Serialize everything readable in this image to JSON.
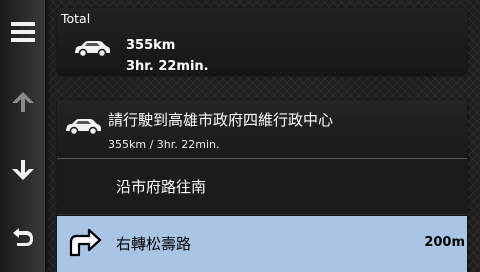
{
  "sidebar": {
    "buttons": [
      {
        "name": "menu",
        "icon": "menu-icon"
      },
      {
        "name": "scroll-up",
        "icon": "arrow-up-icon"
      },
      {
        "name": "scroll-down",
        "icon": "arrow-down-icon"
      },
      {
        "name": "back",
        "icon": "back-icon"
      }
    ]
  },
  "summary": {
    "label": "Total",
    "distance": "355km",
    "time": "3hr. 22min.",
    "icon": "car-icon"
  },
  "route": {
    "destination": {
      "title": "請行駛到高雄市政府四維行政中心",
      "subtitle": "355km / 3hr. 22min.",
      "icon": "car-icon"
    },
    "steps": [
      {
        "instruction": "沿市府路往南",
        "distance": ""
      },
      {
        "instruction": "右轉松壽路",
        "distance": "200m",
        "icon": "turn-right-icon",
        "selected": true
      }
    ]
  },
  "colors": {
    "selected_row": "#a8c5e6",
    "background": "#1e1e1e"
  }
}
